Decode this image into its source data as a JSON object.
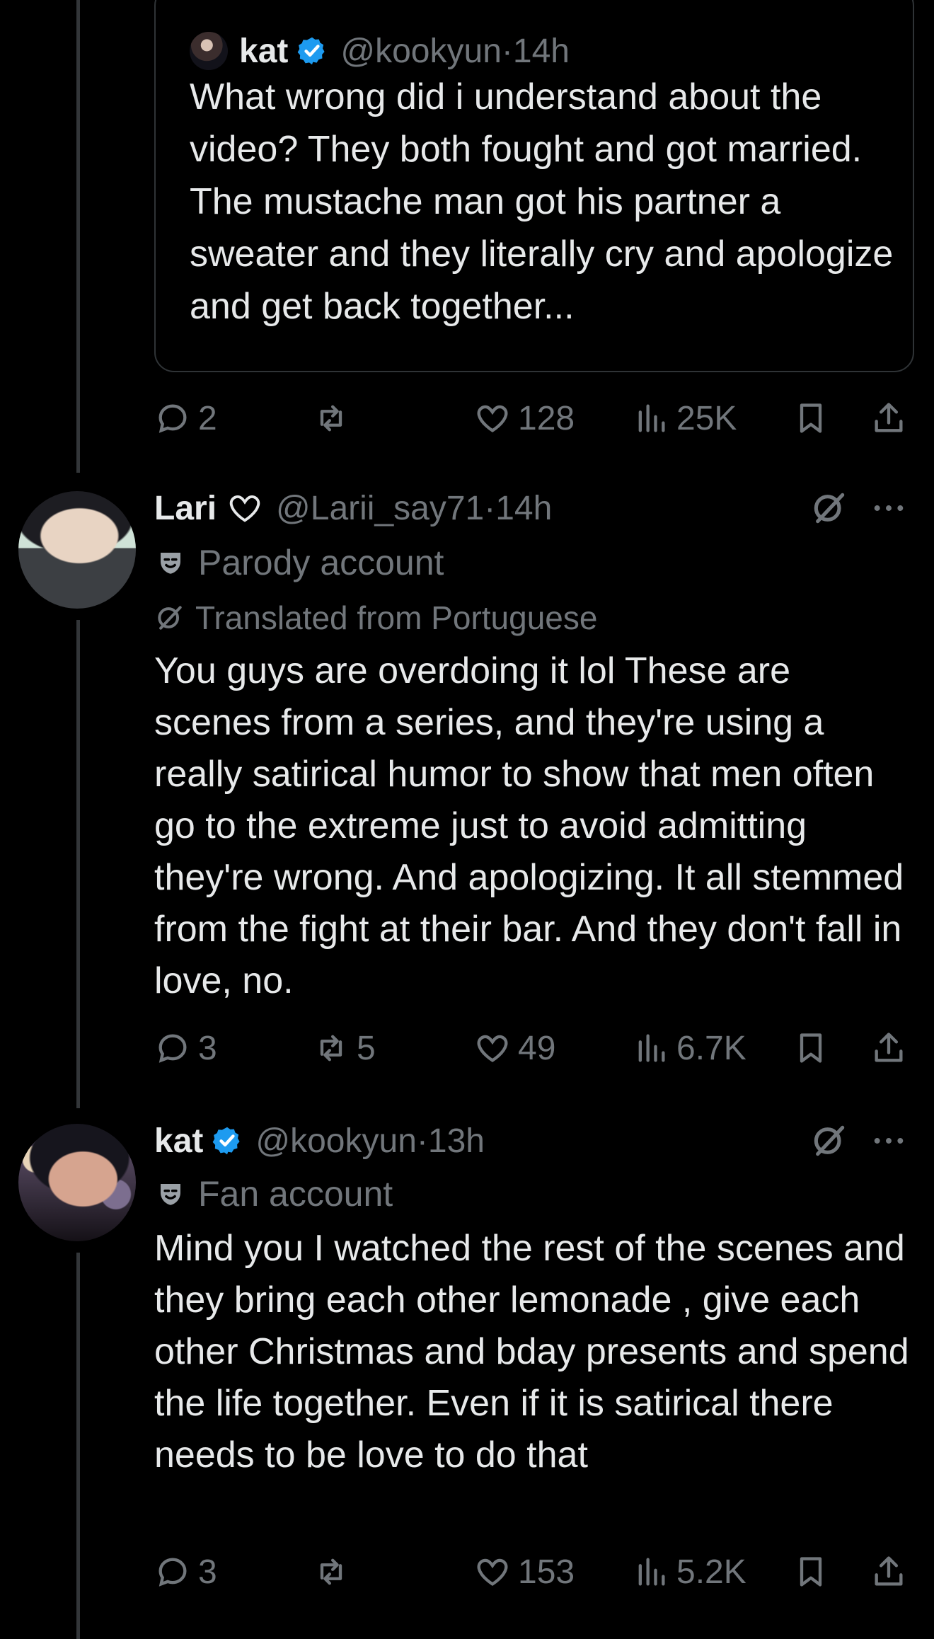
{
  "quoted_post": {
    "name": "kat",
    "handle": "@kookyun",
    "separator": "·",
    "time": "14h",
    "text": "What wrong did i understand about the video? They both fought and got married. The mustache man got his partner a sweater and they literally cry and apologize and get back together..."
  },
  "quoted_actions": {
    "replies": "2",
    "reposts": "",
    "likes": "128",
    "views": "25K"
  },
  "reply_1": {
    "name": "Lari",
    "handle": "@Larii_say71",
    "separator": "·",
    "time": "14h",
    "account_label": "Parody account",
    "translated_label": "Translated from Portuguese",
    "text": "You guys are overdoing it lol These are scenes from a series, and they're using a really satirical humor to show that men often go to the extreme just to avoid admitting they're wrong. And apologizing. It all stemmed from the fight at their bar. And they don't fall in love, no.",
    "actions": {
      "replies": "3",
      "reposts": "5",
      "likes": "49",
      "views": "6.7K"
    }
  },
  "reply_2": {
    "name": "kat",
    "handle": "@kookyun",
    "separator": "·",
    "time": "13h",
    "account_label": "Fan account",
    "text": "Mind you I watched the rest of the scenes and they bring each other lemonade , give each other Christmas and bday presents and spend the life together. Even if it is satirical there needs to be love to do that",
    "actions": {
      "replies": "3",
      "reposts": "",
      "likes": "153",
      "views": "5.2K"
    }
  },
  "colors": {
    "background": "#000000",
    "text": "#e7e9ea",
    "muted": "#71767b",
    "verified": "#1d9bf0",
    "thread_line": "#333639"
  },
  "icons": [
    "reply-icon",
    "repost-icon",
    "like-icon",
    "views-icon",
    "bookmark-icon",
    "share-icon",
    "verified-badge-icon",
    "grok-icon",
    "more-icon",
    "mask-icon",
    "translate-icon"
  ]
}
